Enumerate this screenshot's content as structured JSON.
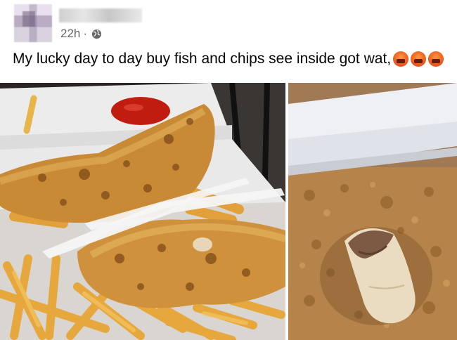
{
  "post": {
    "timestamp": "22h",
    "separator": "·",
    "text": "My lucky day to day buy fish and chips see inside got wat,",
    "emojis": [
      "angry-face-icon",
      "angry-face-icon",
      "angry-face-icon"
    ],
    "privacy_icon": "globe-icon"
  }
}
